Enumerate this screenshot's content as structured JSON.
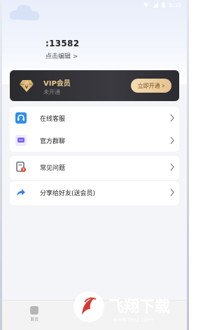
{
  "status_bar": {
    "time": "5:35"
  },
  "profile": {
    "user_id": ":13582",
    "edit_label": "点击编辑 >"
  },
  "vip": {
    "title": "VIP会员",
    "status": "未开通",
    "cta": "立即开通 >"
  },
  "menu": [
    {
      "label": "在线客服"
    },
    {
      "label": "官方群聊"
    },
    {
      "label": "常见问题"
    },
    {
      "label": "分享给好友(送会员)"
    }
  ],
  "bottom_nav": {
    "home": "首页"
  },
  "watermark": {
    "text": "飞翔下载",
    "url": "www.fxxz.com"
  },
  "colors": {
    "vip_gold": "#e8c98c",
    "accent_blue": "#2f8fe8",
    "accent_purple": "#7a5cff"
  }
}
